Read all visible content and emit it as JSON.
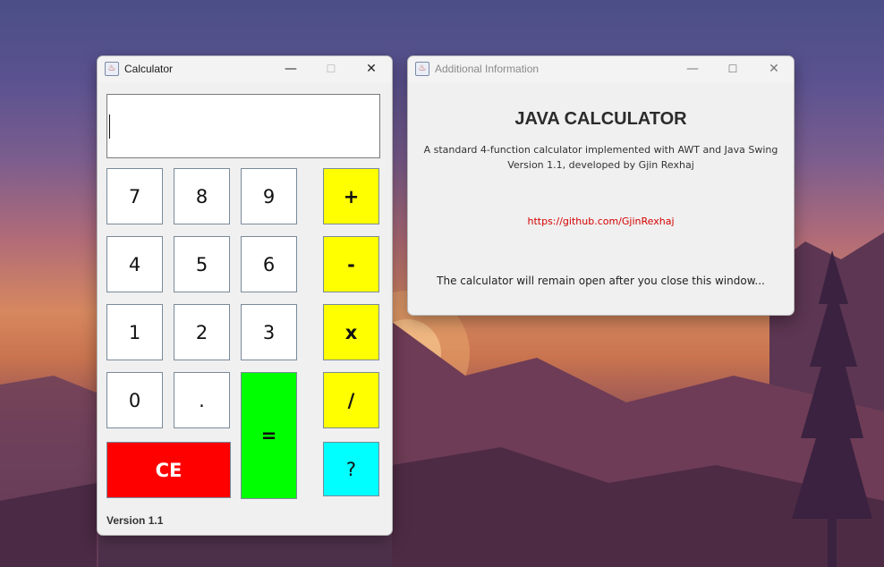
{
  "calculator": {
    "window_title": "Calculator",
    "display_value": "",
    "buttons": {
      "seven": "7",
      "eight": "8",
      "nine": "9",
      "four": "4",
      "five": "5",
      "six": "6",
      "one": "1",
      "two": "2",
      "three": "3",
      "zero": "0",
      "dot": ".",
      "equals": "=",
      "plus": "+",
      "minus": "-",
      "multiply": "x",
      "divide": "/",
      "clear": "CE",
      "help": "?"
    },
    "version": "Version 1.1"
  },
  "info": {
    "window_title": "Additional Information",
    "heading": "JAVA CALCULATOR",
    "description": "A standard 4-function calculator implemented with AWT and Java Swing",
    "credit": "Version 1.1, developed by Gjin Rexhaj",
    "link": "https://github.com/GjinRexhaj",
    "note": "The calculator will remain open after you close this window..."
  },
  "window_controls": {
    "minimize": "—",
    "maximize": "☐",
    "close": "✕"
  },
  "colors": {
    "operator": "#ffff00",
    "equals": "#00ff00",
    "clear": "#ff0000",
    "help": "#00ffff",
    "link": "#d40000"
  }
}
